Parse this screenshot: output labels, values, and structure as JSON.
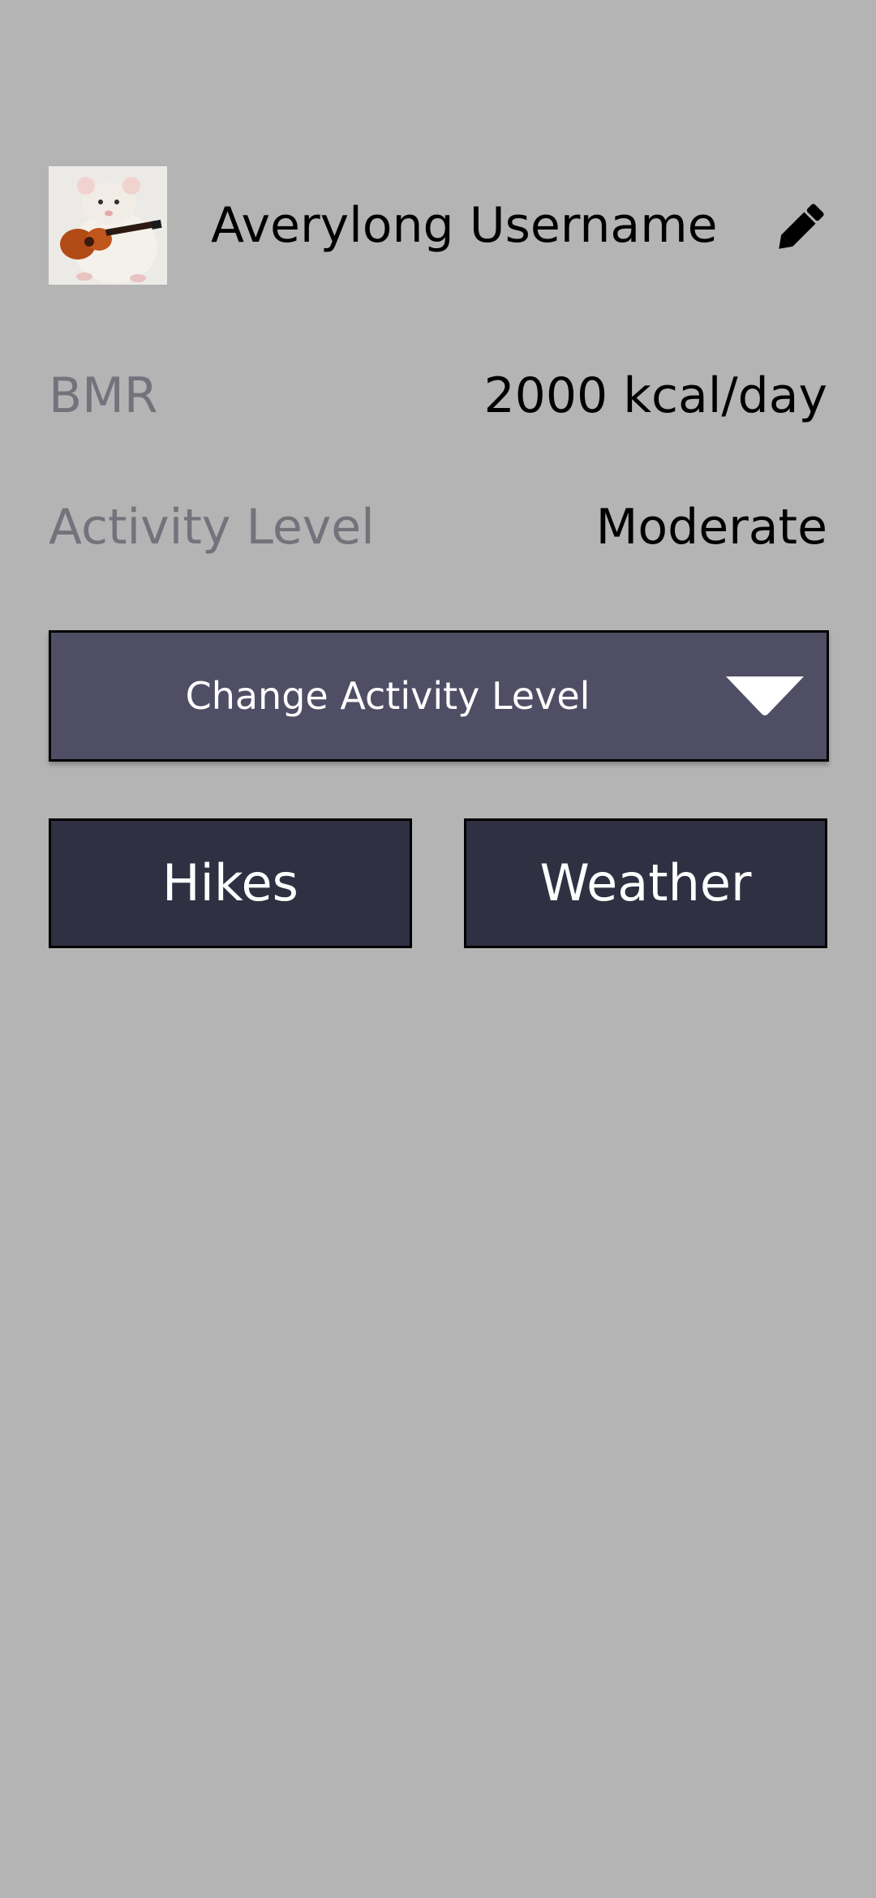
{
  "profile": {
    "avatar_icon": "rat-with-guitar-avatar",
    "username": "Averylong Username",
    "edit_icon": "pencil-icon"
  },
  "stats": {
    "bmr_label": "BMR",
    "bmr_value": "2000 kcal/day",
    "activity_label": "Activity Level",
    "activity_value": "Moderate"
  },
  "activity_dropdown": {
    "label": "Change Activity Level",
    "arrow_icon": "triangle-down-icon"
  },
  "nav": {
    "hikes_label": "Hikes",
    "weather_label": "Weather"
  },
  "colors": {
    "background": "#b4b4b4",
    "dropdown": "#4f4e65",
    "button": "#2f3042",
    "muted_text": "#74737c"
  }
}
